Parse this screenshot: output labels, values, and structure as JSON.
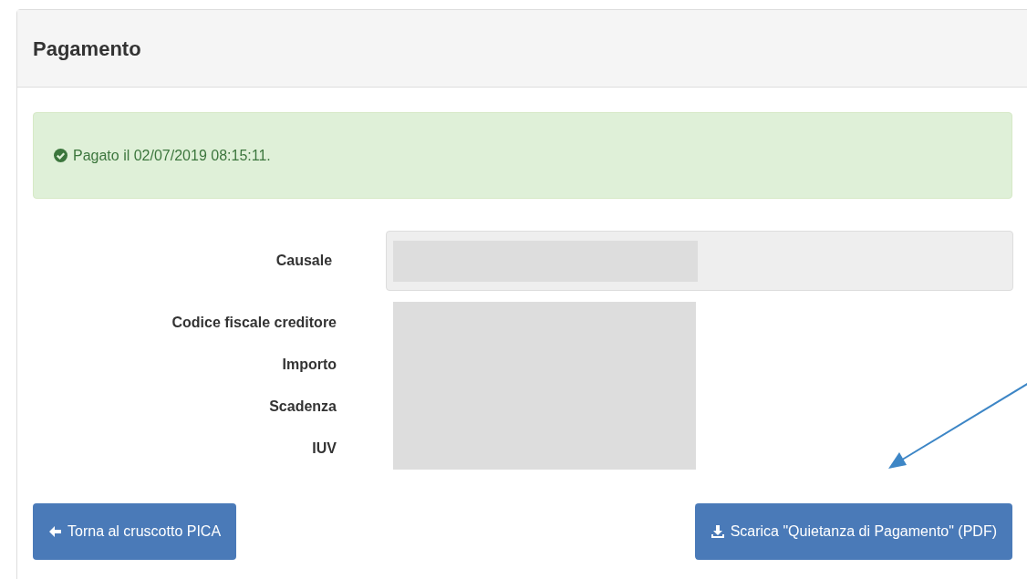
{
  "panel": {
    "title": "Pagamento"
  },
  "alert": {
    "text": "Pagato il 02/07/2019 08:15:11."
  },
  "fields": [
    {
      "label": "Causale",
      "kind": "input"
    },
    {
      "label": "Codice fiscale creditore",
      "kind": "text"
    },
    {
      "label": "Importo",
      "kind": "text"
    },
    {
      "label": "Scadenza",
      "kind": "text"
    },
    {
      "label": "IUV",
      "kind": "text"
    }
  ],
  "buttons": [
    {
      "label": "Torna al cruscotto PICA",
      "kind": "back"
    },
    {
      "label": "Scarica \"Quietanza di Pagamento\" (PDF)",
      "kind": "download"
    }
  ]
}
